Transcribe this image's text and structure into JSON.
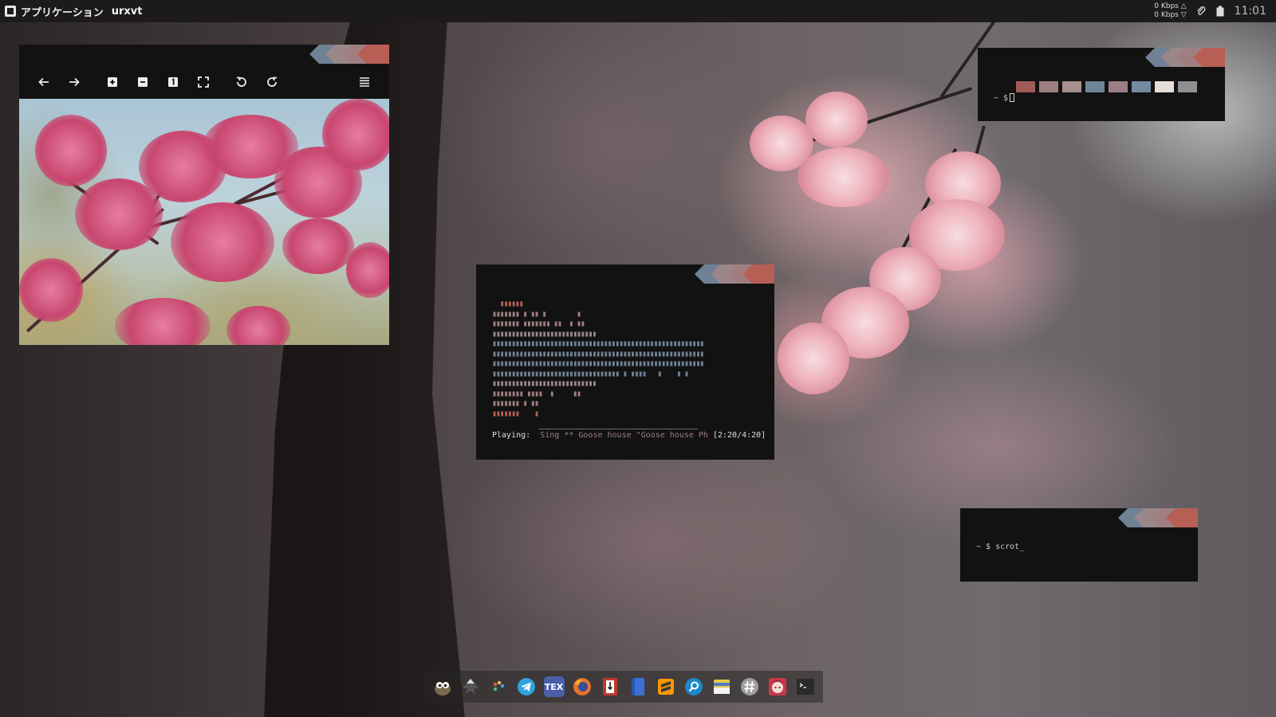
{
  "topbar": {
    "apps_label": "アプリケーション",
    "active_window": "urxvt",
    "net_up": "0 Kbps △",
    "net_down": "0 Kbps ▽",
    "clock": "11:01"
  },
  "decorations": [
    "#6f8194",
    "#9a8789",
    "#a07e80",
    "#b85f55"
  ],
  "viewer": {
    "toolbar": [
      "arrow-left-icon",
      "arrow-right-icon",
      "zoom-in-icon",
      "zoom-out-icon",
      "actual-size-icon",
      "fullscreen-icon",
      "rotate-left-icon",
      "rotate-right-icon",
      "menu-icon"
    ]
  },
  "terminal_top": {
    "prompt": "~ $",
    "swatches": [
      "#a05b56",
      "#9c7f80",
      "#a68f8d",
      "#6f8496",
      "#9c7f86",
      "#738aa0",
      "#e6dcd8",
      "#8f8f8f"
    ]
  },
  "music": {
    "status_label": "Playing:",
    "track": "Sing ** Goose house \"Goose house Ph",
    "time": "[2:20/4:20]"
  },
  "terminal_bottom": {
    "prompt": "~ $ scrot_"
  },
  "dock": {
    "items": [
      "gimp-icon",
      "inkscape-icon",
      "color-palette-icon",
      "telegram-icon",
      "tex-icon",
      "firefox-icon",
      "archive-manager-icon",
      "notes-icon",
      "sublime-text-icon",
      "search-app-icon",
      "file-manager-icon",
      "hashtag-app-icon",
      "anime-avatar-icon",
      "terminal-icon"
    ],
    "tex_label": "TEX"
  }
}
